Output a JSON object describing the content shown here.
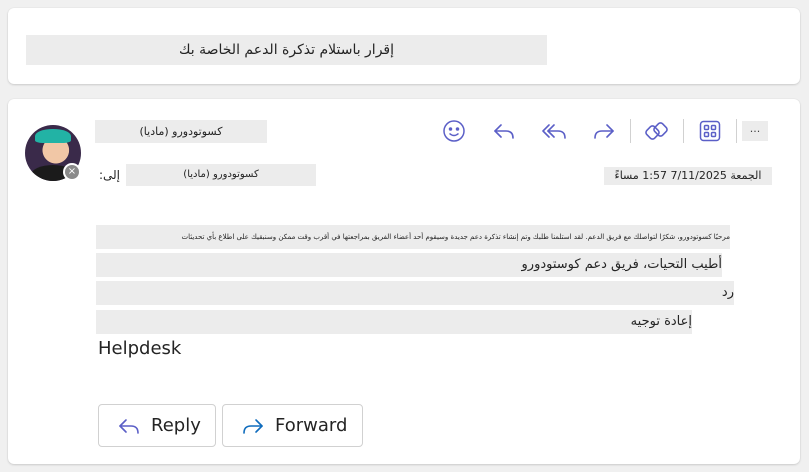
{
  "banner": {
    "text": "إقرار باستلام تذكرة الدعم الخاصة بك"
  },
  "message": {
    "sender": "كسوتودورو (ماديا)",
    "to_label": "إلى:",
    "to_value": "كسوتودورو (ماديا)",
    "date": "الجمعة 7/11/2025 1:57 مساءً",
    "more_label": "...",
    "body": {
      "line1": "مرحبًا كسوتودورو، شكرًا لتواصلك مع فريق الدعم. لقد استلمنا طلبك وتم إنشاء تذكرة دعم جديدة وسيقوم أحد أعضاء الفريق بمراجعتها في أقرب وقت ممكن وسنبقيك على اطلاع بأي تحديثات",
      "line2": "أطيب التحيات، فريق دعم كوستودورو",
      "line3": "رد",
      "line4": "إعادة توجيه",
      "signature": "Helpdesk"
    }
  },
  "actions": {
    "reply_label": "Reply",
    "forward_label": "Forward"
  },
  "colors": {
    "accent": "#5b5fc7",
    "forward_blue": "#0f6cbd"
  }
}
